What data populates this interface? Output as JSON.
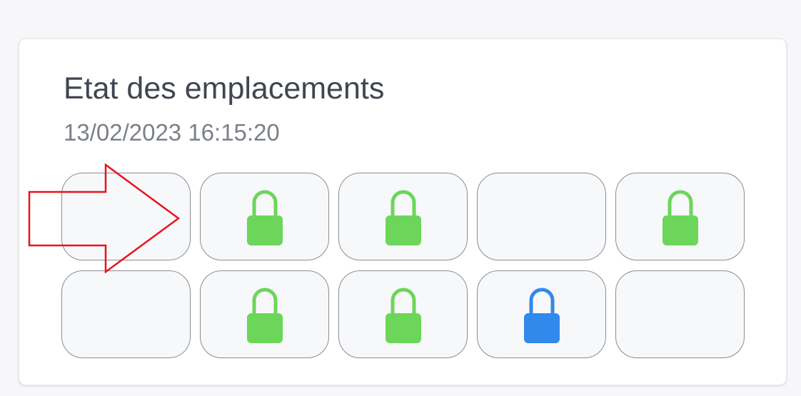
{
  "panel": {
    "title": "Etat des emplacements",
    "timestamp": "13/02/2023 16:15:20"
  },
  "colors": {
    "locked_green": "#6cd65a",
    "locked_blue": "#3189ec",
    "annotation_arrow": "#e8141b"
  },
  "slots": [
    {
      "row": 1,
      "col": 1,
      "state": "empty"
    },
    {
      "row": 1,
      "col": 2,
      "state": "locked",
      "icon": "padlock-icon",
      "color": "#6cd65a"
    },
    {
      "row": 1,
      "col": 3,
      "state": "locked",
      "icon": "padlock-icon",
      "color": "#6cd65a"
    },
    {
      "row": 1,
      "col": 4,
      "state": "empty"
    },
    {
      "row": 1,
      "col": 5,
      "state": "locked",
      "icon": "padlock-icon",
      "color": "#6cd65a"
    },
    {
      "row": 2,
      "col": 1,
      "state": "empty"
    },
    {
      "row": 2,
      "col": 2,
      "state": "locked",
      "icon": "padlock-icon",
      "color": "#6cd65a"
    },
    {
      "row": 2,
      "col": 3,
      "state": "locked",
      "icon": "padlock-icon",
      "color": "#6cd65a"
    },
    {
      "row": 2,
      "col": 4,
      "state": "locked",
      "icon": "padlock-icon",
      "color": "#3189ec"
    },
    {
      "row": 2,
      "col": 5,
      "state": "empty"
    }
  ],
  "annotation": {
    "icon": "arrow-right-icon",
    "target": "slot-row-1-col-1"
  }
}
